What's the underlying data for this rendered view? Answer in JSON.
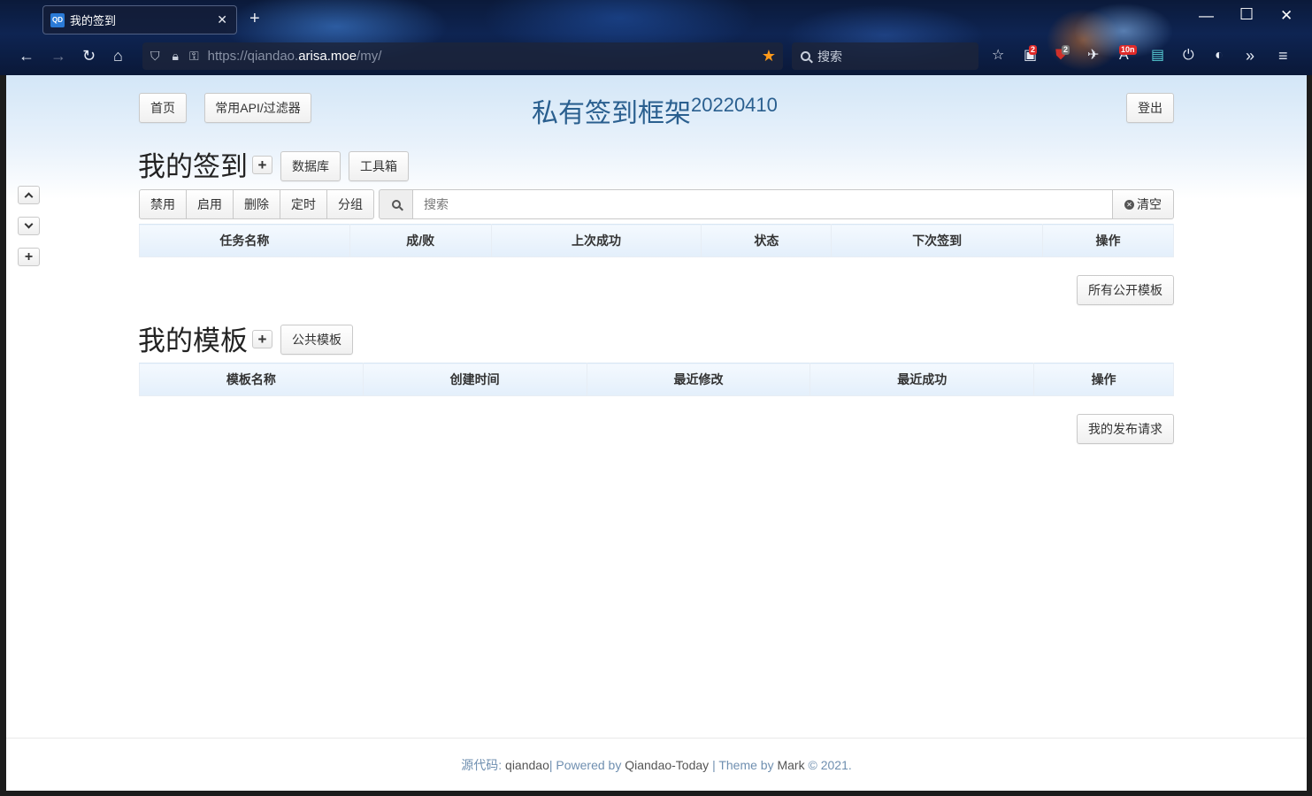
{
  "browser": {
    "tab_title": "我的签到",
    "tab_favicon_text": "QD",
    "url_prefix": "https://qiandao.",
    "url_host": "arisa.moe",
    "url_path": "/my/",
    "search_placeholder": "搜索",
    "badges": {
      "ext1": "2",
      "ext2": "2",
      "ext3": "10n"
    }
  },
  "header": {
    "home_label": "首页",
    "api_label": "常用API/过滤器",
    "title": "私有签到框架",
    "version": "20220410",
    "logout_label": "登出"
  },
  "tasks": {
    "heading": "我的签到",
    "add_symbol": "+",
    "database_label": "数据库",
    "toolbox_label": "工具箱",
    "actions": [
      "禁用",
      "启用",
      "删除",
      "定时",
      "分组"
    ],
    "search_placeholder": "搜索",
    "clear_label": "清空",
    "columns": [
      "任务名称",
      "成/败",
      "上次成功",
      "状态",
      "下次签到",
      "操作"
    ],
    "all_templates_label": "所有公开模板"
  },
  "templates": {
    "heading": "我的模板",
    "add_symbol": "+",
    "public_label": "公共模板",
    "columns": [
      "模板名称",
      "创建时间",
      "最近修改",
      "最近成功",
      "操作"
    ],
    "my_requests_label": "我的发布请求"
  },
  "footer": {
    "source_label": "源代码:",
    "source_name": "qiandao",
    "powered_label": "| Powered by",
    "powered_name": "Qiandao-Today",
    "theme_label": "| Theme by",
    "theme_name": "Mark",
    "copyright": "© 2021."
  }
}
